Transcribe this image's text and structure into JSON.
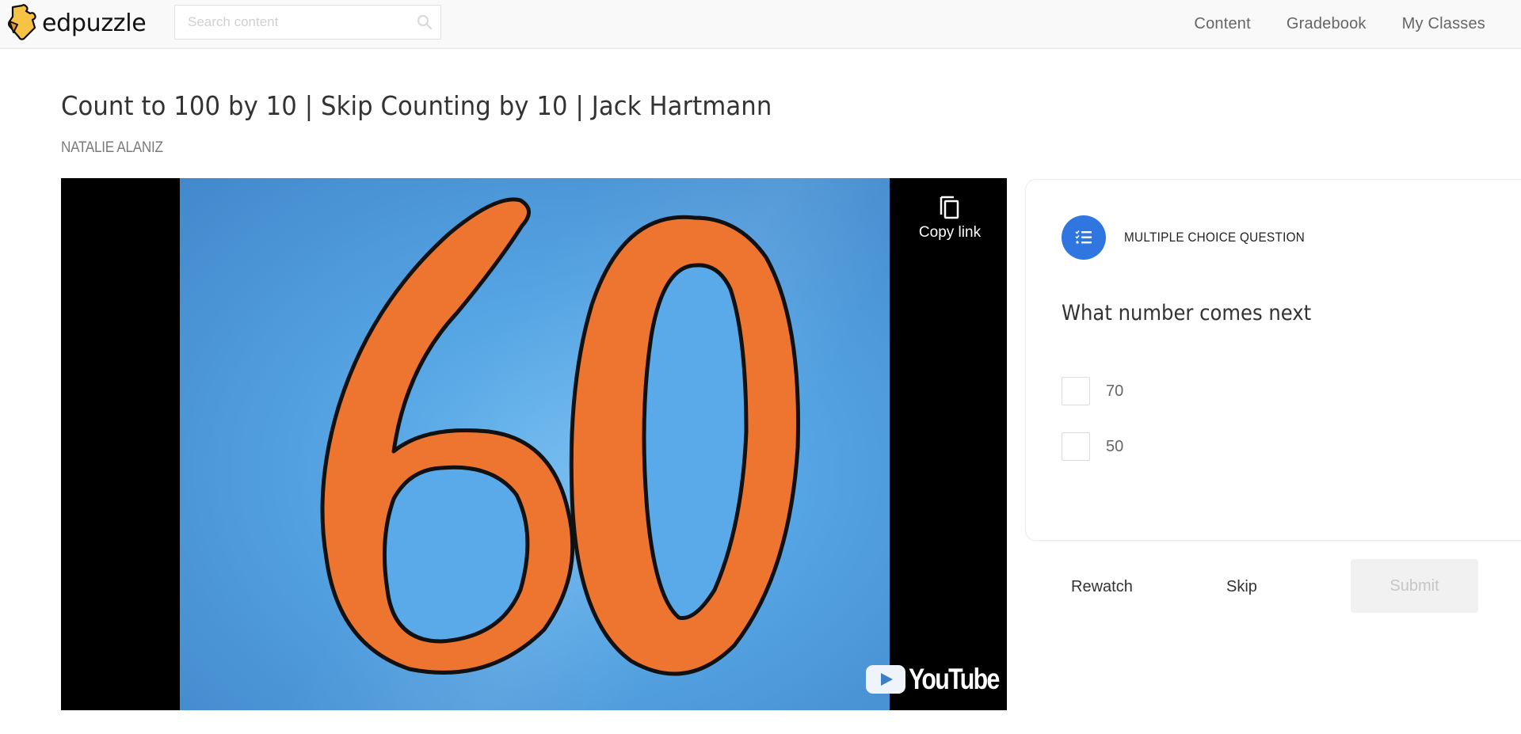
{
  "header": {
    "logo_text": "edpuzzle",
    "search": {
      "placeholder": "Search content",
      "value": ""
    },
    "nav": [
      {
        "label": "Content"
      },
      {
        "label": "Gradebook"
      },
      {
        "label": "My Classes"
      }
    ]
  },
  "video": {
    "title": "Count to 100 by 10 | Skip Counting by 10 | Jack Hartmann",
    "author": "NATALIE ALANIZ",
    "frame_number": "60",
    "copy_link_label": "Copy link",
    "provider_logo_text": "YouTube",
    "colors": {
      "background_blue": "#56a5e4",
      "digit_orange": "#ee7530",
      "outline": "#111111"
    }
  },
  "question": {
    "type_label": "MULTIPLE CHOICE QUESTION",
    "type_icon": "checklist-icon",
    "accent_color": "#2f76e0",
    "text": "What number comes next",
    "options": [
      {
        "label": "70",
        "checked": false
      },
      {
        "label": "50",
        "checked": false
      }
    ]
  },
  "actions": {
    "rewatch_label": "Rewatch",
    "skip_label": "Skip",
    "submit_label": "Submit",
    "submit_disabled": true
  }
}
